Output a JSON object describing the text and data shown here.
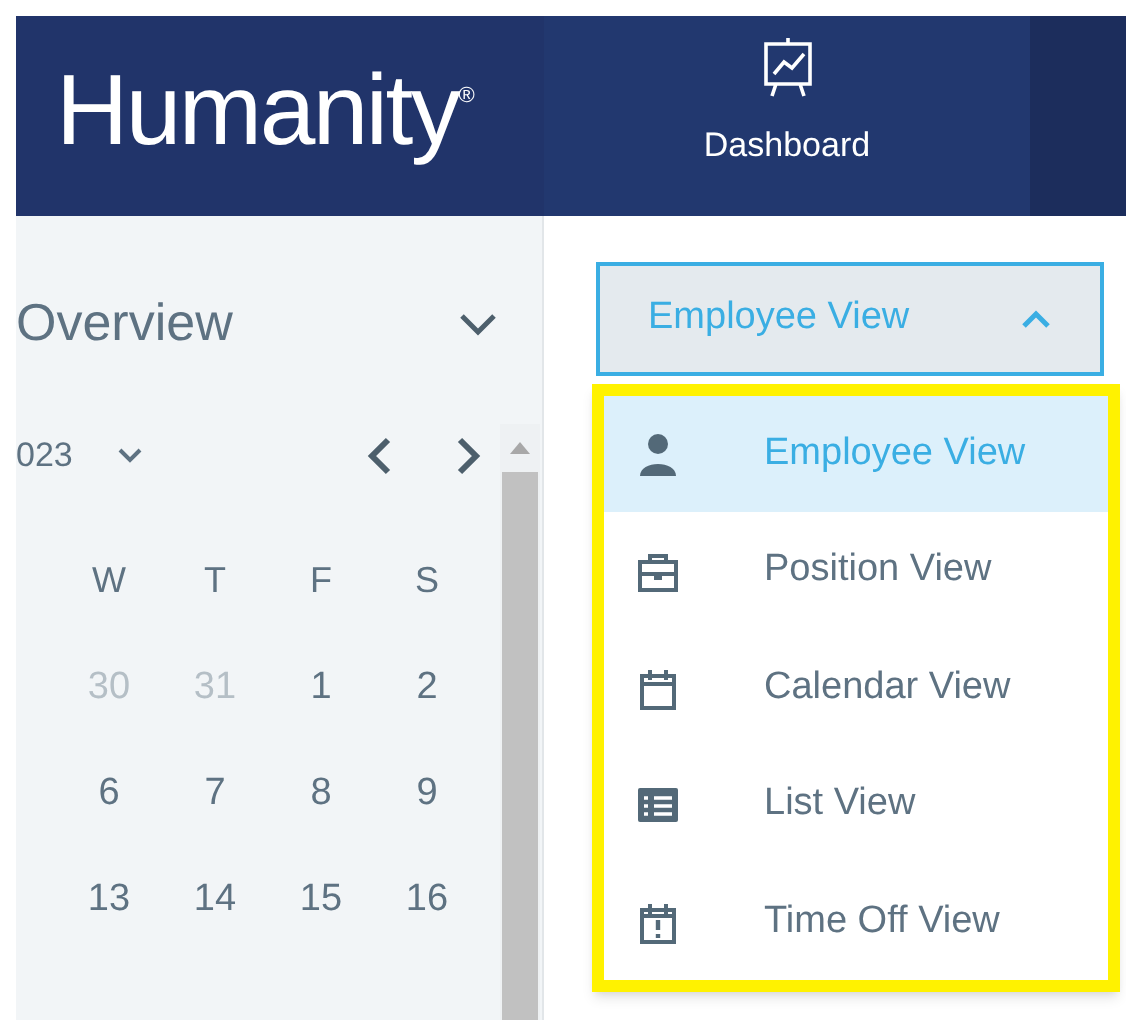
{
  "header": {
    "logo": "Humanity",
    "logo_mark": "®",
    "tabs": [
      {
        "label": "Dashboard",
        "selected": true
      }
    ]
  },
  "sidebar": {
    "title": "Overview",
    "calendar": {
      "month_label": "023",
      "weekdays": [
        "W",
        "T",
        "F",
        "S"
      ],
      "weeks": [
        [
          {
            "day": "30",
            "muted": true
          },
          {
            "day": "31",
            "muted": true
          },
          {
            "day": "1",
            "muted": false
          },
          {
            "day": "2",
            "muted": false
          }
        ],
        [
          {
            "day": "6",
            "muted": false
          },
          {
            "day": "7",
            "muted": false
          },
          {
            "day": "8",
            "muted": false
          },
          {
            "day": "9",
            "muted": false
          }
        ],
        [
          {
            "day": "13",
            "muted": false
          },
          {
            "day": "14",
            "muted": false
          },
          {
            "day": "15",
            "muted": false
          },
          {
            "day": "16",
            "muted": false
          }
        ]
      ]
    }
  },
  "view_dropdown": {
    "value": "Employee View",
    "expanded": true,
    "options": [
      {
        "label": "Employee View",
        "kind": "person",
        "selected": true
      },
      {
        "label": "Position View",
        "kind": "briefcase",
        "selected": false
      },
      {
        "label": "Calendar View",
        "kind": "calendar",
        "selected": false
      },
      {
        "label": "List View",
        "kind": "list",
        "selected": false
      },
      {
        "label": "Time Off View",
        "kind": "timeoff",
        "selected": false
      }
    ]
  }
}
